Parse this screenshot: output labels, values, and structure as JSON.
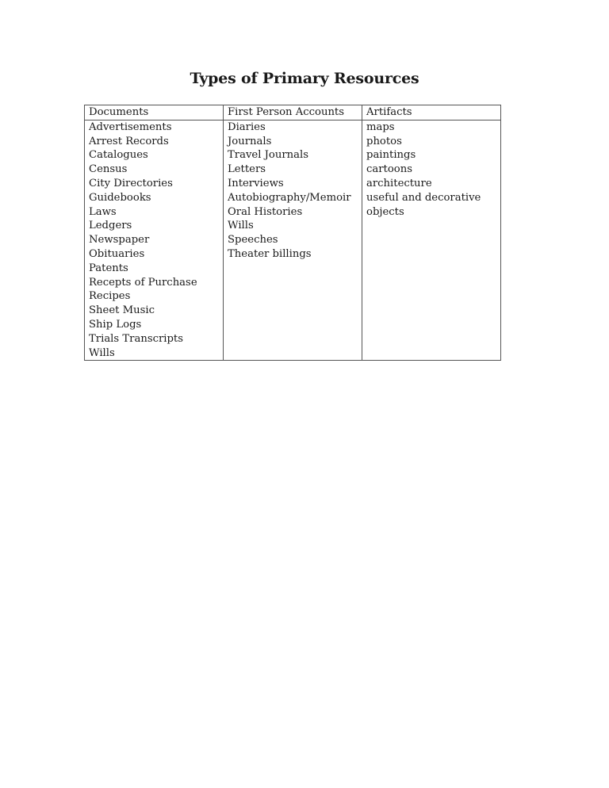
{
  "title": "Types of Primary Resources",
  "columns": [
    {
      "header": "Documents",
      "items": [
        "Advertisements",
        "Arrest Records",
        "Catalogues",
        "Census",
        "City Directories",
        "Guidebooks",
        "Laws",
        "Ledgers",
        "Newspaper",
        "Obituaries",
        "Patents",
        "Recepts of Purchase",
        "Recipes",
        "Sheet Music",
        "Ship Logs",
        "Trials Transcripts",
        "Wills"
      ]
    },
    {
      "header": "First Person Accounts",
      "items": [
        "Diaries",
        "Journals",
        "Travel Journals",
        "Letters",
        "Interviews",
        "Autobiography/Memoir",
        "Oral Histories",
        "Wills",
        "Speeches",
        "Theater billings"
      ]
    },
    {
      "header": "Artifacts",
      "items": [
        "maps",
        "photos",
        "paintings",
        "cartoons",
        "architecture",
        "useful and decorative",
        "objects"
      ]
    }
  ]
}
